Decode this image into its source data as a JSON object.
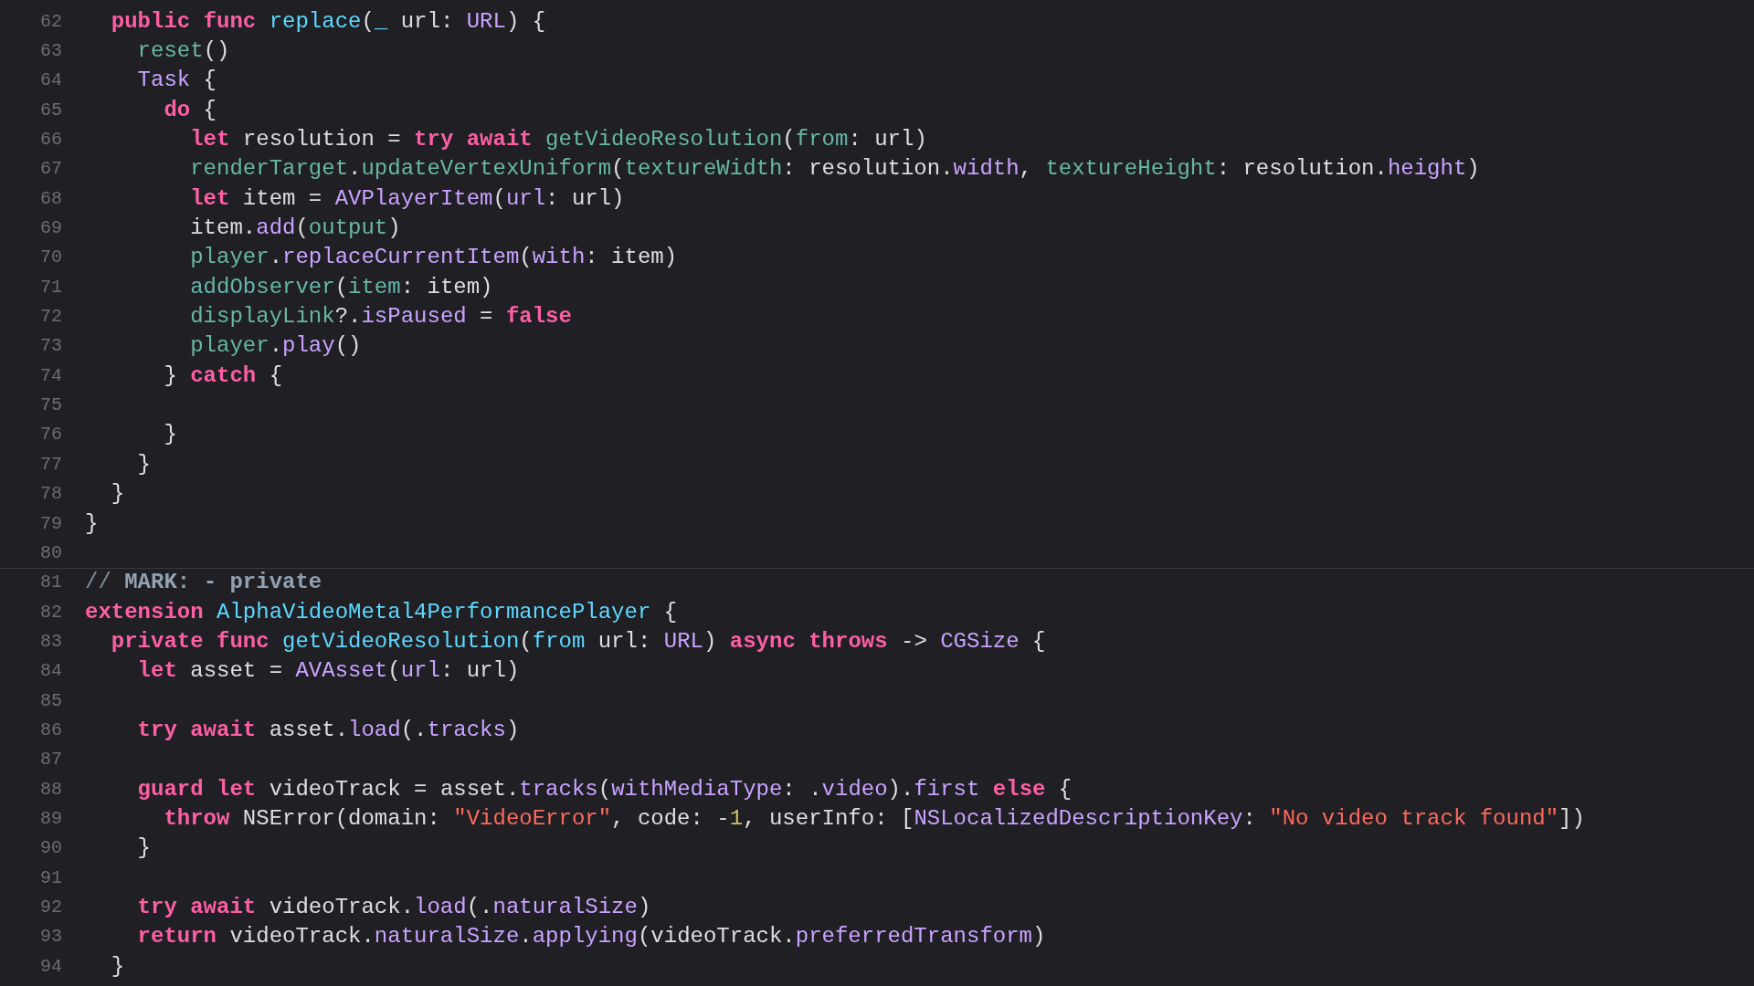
{
  "editor": {
    "lines": [
      {
        "number": "62",
        "tokens": [
          {
            "kind": "keyword",
            "text": "  public "
          },
          {
            "kind": "keyword",
            "text": "func "
          },
          {
            "kind": "declaration",
            "text": "replace"
          },
          {
            "kind": "plain",
            "text": "("
          },
          {
            "kind": "declaration",
            "text": "_"
          },
          {
            "kind": "plain",
            "text": " url: "
          },
          {
            "kind": "system",
            "text": "URL"
          },
          {
            "kind": "plain",
            "text": ") {"
          }
        ]
      },
      {
        "number": "63",
        "tokens": [
          {
            "kind": "project",
            "text": "    reset"
          },
          {
            "kind": "plain",
            "text": "()"
          }
        ]
      },
      {
        "number": "64",
        "tokens": [
          {
            "kind": "system",
            "text": "    Task"
          },
          {
            "kind": "plain",
            "text": " {"
          }
        ]
      },
      {
        "number": "65",
        "tokens": [
          {
            "kind": "keyword",
            "text": "      do"
          },
          {
            "kind": "plain",
            "text": " {"
          }
        ]
      },
      {
        "number": "66",
        "tokens": [
          {
            "kind": "keyword",
            "text": "        let"
          },
          {
            "kind": "plain",
            "text": " resolution = "
          },
          {
            "kind": "keyword",
            "text": "try "
          },
          {
            "kind": "keyword",
            "text": "await "
          },
          {
            "kind": "project",
            "text": "getVideoResolution"
          },
          {
            "kind": "plain",
            "text": "("
          },
          {
            "kind": "project",
            "text": "from"
          },
          {
            "kind": "plain",
            "text": ": url)"
          }
        ]
      },
      {
        "number": "67",
        "tokens": [
          {
            "kind": "project",
            "text": "        renderTarget"
          },
          {
            "kind": "plain",
            "text": "."
          },
          {
            "kind": "project",
            "text": "updateVertexUniform"
          },
          {
            "kind": "plain",
            "text": "("
          },
          {
            "kind": "project",
            "text": "textureWidth"
          },
          {
            "kind": "plain",
            "text": ": resolution."
          },
          {
            "kind": "system",
            "text": "width"
          },
          {
            "kind": "plain",
            "text": ", "
          },
          {
            "kind": "project",
            "text": "textureHeight"
          },
          {
            "kind": "plain",
            "text": ": resolution."
          },
          {
            "kind": "system",
            "text": "height"
          },
          {
            "kind": "plain",
            "text": ")"
          }
        ]
      },
      {
        "number": "68",
        "tokens": [
          {
            "kind": "keyword",
            "text": "        let"
          },
          {
            "kind": "plain",
            "text": " item = "
          },
          {
            "kind": "system",
            "text": "AVPlayerItem"
          },
          {
            "kind": "plain",
            "text": "("
          },
          {
            "kind": "system",
            "text": "url"
          },
          {
            "kind": "plain",
            "text": ": url)"
          }
        ]
      },
      {
        "number": "69",
        "tokens": [
          {
            "kind": "plain",
            "text": "        item."
          },
          {
            "kind": "system",
            "text": "add"
          },
          {
            "kind": "plain",
            "text": "("
          },
          {
            "kind": "project",
            "text": "output"
          },
          {
            "kind": "plain",
            "text": ")"
          }
        ]
      },
      {
        "number": "70",
        "tokens": [
          {
            "kind": "project",
            "text": "        player"
          },
          {
            "kind": "plain",
            "text": "."
          },
          {
            "kind": "system",
            "text": "replaceCurrentItem"
          },
          {
            "kind": "plain",
            "text": "("
          },
          {
            "kind": "system",
            "text": "with"
          },
          {
            "kind": "plain",
            "text": ": item)"
          }
        ]
      },
      {
        "number": "71",
        "tokens": [
          {
            "kind": "project",
            "text": "        addObserver"
          },
          {
            "kind": "plain",
            "text": "("
          },
          {
            "kind": "project",
            "text": "item"
          },
          {
            "kind": "plain",
            "text": ": item)"
          }
        ]
      },
      {
        "number": "72",
        "tokens": [
          {
            "kind": "project",
            "text": "        displayLink"
          },
          {
            "kind": "plain",
            "text": "?."
          },
          {
            "kind": "system",
            "text": "isPaused"
          },
          {
            "kind": "plain",
            "text": " = "
          },
          {
            "kind": "keyword",
            "text": "false"
          }
        ]
      },
      {
        "number": "73",
        "tokens": [
          {
            "kind": "project",
            "text": "        player"
          },
          {
            "kind": "plain",
            "text": "."
          },
          {
            "kind": "system",
            "text": "play"
          },
          {
            "kind": "plain",
            "text": "()"
          }
        ]
      },
      {
        "number": "74",
        "tokens": [
          {
            "kind": "plain",
            "text": "      } "
          },
          {
            "kind": "keyword",
            "text": "catch"
          },
          {
            "kind": "plain",
            "text": " {"
          }
        ]
      },
      {
        "number": "75"
      },
      {
        "number": "76",
        "tokens": [
          {
            "kind": "plain",
            "text": "      }"
          }
        ]
      },
      {
        "number": "77",
        "tokens": [
          {
            "kind": "plain",
            "text": "    }"
          }
        ]
      },
      {
        "number": "78",
        "tokens": [
          {
            "kind": "plain",
            "text": "  }"
          }
        ]
      },
      {
        "number": "79",
        "tokens": [
          {
            "kind": "plain",
            "text": "}"
          }
        ]
      },
      {
        "number": "80"
      },
      {
        "number": "81",
        "separator_above": true,
        "tokens": [
          {
            "kind": "comment",
            "text": "// "
          },
          {
            "kind": "mark",
            "text": "MARK: - private"
          }
        ]
      },
      {
        "number": "82",
        "tokens": [
          {
            "kind": "keyword",
            "text": "extension "
          },
          {
            "kind": "declaration",
            "text": "AlphaVideoMetal4PerformancePlayer"
          },
          {
            "kind": "plain",
            "text": " {"
          }
        ]
      },
      {
        "number": "83",
        "tokens": [
          {
            "kind": "keyword",
            "text": "  private "
          },
          {
            "kind": "keyword",
            "text": "func "
          },
          {
            "kind": "declaration",
            "text": "getVideoResolution"
          },
          {
            "kind": "plain",
            "text": "("
          },
          {
            "kind": "declaration",
            "text": "from"
          },
          {
            "kind": "plain",
            "text": " url: "
          },
          {
            "kind": "system",
            "text": "URL"
          },
          {
            "kind": "plain",
            "text": ") "
          },
          {
            "kind": "keyword",
            "text": "async "
          },
          {
            "kind": "keyword",
            "text": "throws"
          },
          {
            "kind": "plain",
            "text": " -> "
          },
          {
            "kind": "system",
            "text": "CGSize"
          },
          {
            "kind": "plain",
            "text": " {"
          }
        ]
      },
      {
        "number": "84",
        "tokens": [
          {
            "kind": "keyword",
            "text": "    let"
          },
          {
            "kind": "plain",
            "text": " asset = "
          },
          {
            "kind": "system",
            "text": "AVAsset"
          },
          {
            "kind": "plain",
            "text": "("
          },
          {
            "kind": "system",
            "text": "url"
          },
          {
            "kind": "plain",
            "text": ": url)"
          }
        ]
      },
      {
        "number": "85"
      },
      {
        "number": "86",
        "tokens": [
          {
            "kind": "keyword",
            "text": "    try "
          },
          {
            "kind": "keyword",
            "text": "await"
          },
          {
            "kind": "plain",
            "text": " asset."
          },
          {
            "kind": "system",
            "text": "load"
          },
          {
            "kind": "plain",
            "text": "(."
          },
          {
            "kind": "system",
            "text": "tracks"
          },
          {
            "kind": "plain",
            "text": ")"
          }
        ]
      },
      {
        "number": "87"
      },
      {
        "number": "88",
        "tokens": [
          {
            "kind": "keyword",
            "text": "    guard "
          },
          {
            "kind": "keyword",
            "text": "let"
          },
          {
            "kind": "plain",
            "text": " videoTrack = asset."
          },
          {
            "kind": "system",
            "text": "tracks"
          },
          {
            "kind": "plain",
            "text": "("
          },
          {
            "kind": "system",
            "text": "withMediaType"
          },
          {
            "kind": "plain",
            "text": ": ."
          },
          {
            "kind": "system",
            "text": "video"
          },
          {
            "kind": "plain",
            "text": ")."
          },
          {
            "kind": "system",
            "text": "first"
          },
          {
            "kind": "keyword",
            "text": " else"
          },
          {
            "kind": "plain",
            "text": " {"
          }
        ]
      },
      {
        "number": "89",
        "tokens": [
          {
            "kind": "keyword",
            "text": "      throw"
          },
          {
            "kind": "plain",
            "text": " NSError(domain: "
          },
          {
            "kind": "string",
            "text": "\"VideoError\""
          },
          {
            "kind": "plain",
            "text": ", code: -"
          },
          {
            "kind": "number",
            "text": "1"
          },
          {
            "kind": "plain",
            "text": ", userInfo: ["
          },
          {
            "kind": "system",
            "text": "NSLocalizedDescriptionKey"
          },
          {
            "kind": "plain",
            "text": ": "
          },
          {
            "kind": "string",
            "text": "\"No video track found\""
          },
          {
            "kind": "plain",
            "text": "])"
          }
        ]
      },
      {
        "number": "90",
        "tokens": [
          {
            "kind": "plain",
            "text": "    }"
          }
        ]
      },
      {
        "number": "91"
      },
      {
        "number": "92",
        "tokens": [
          {
            "kind": "keyword",
            "text": "    try "
          },
          {
            "kind": "keyword",
            "text": "await"
          },
          {
            "kind": "plain",
            "text": " videoTrack."
          },
          {
            "kind": "system",
            "text": "load"
          },
          {
            "kind": "plain",
            "text": "(."
          },
          {
            "kind": "system",
            "text": "naturalSize"
          },
          {
            "kind": "plain",
            "text": ")"
          }
        ]
      },
      {
        "number": "93",
        "tokens": [
          {
            "kind": "keyword",
            "text": "    return"
          },
          {
            "kind": "plain",
            "text": " videoTrack."
          },
          {
            "kind": "system",
            "text": "naturalSize"
          },
          {
            "kind": "plain",
            "text": "."
          },
          {
            "kind": "system",
            "text": "applying"
          },
          {
            "kind": "plain",
            "text": "(videoTrack."
          },
          {
            "kind": "system",
            "text": "preferredTransform"
          },
          {
            "kind": "plain",
            "text": ")"
          }
        ]
      },
      {
        "number": "94",
        "tokens": [
          {
            "kind": "plain",
            "text": "  }"
          }
        ]
      }
    ]
  }
}
